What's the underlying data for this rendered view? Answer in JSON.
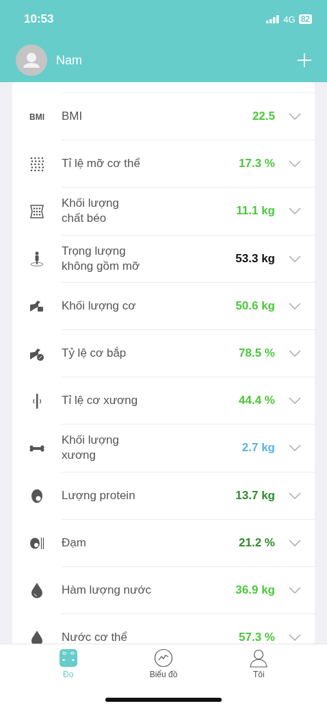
{
  "status_bar": {
    "time": "10:53",
    "network": "4G",
    "battery": "82"
  },
  "header": {
    "user_name": "Nam"
  },
  "metrics": [
    {
      "name": "BMI",
      "value": "22.5",
      "color": "#4cc83c",
      "icon_text": "BMI"
    },
    {
      "name": "Tỉ lệ mỡ cơ thể",
      "value": "17.3 %",
      "color": "#4cc83c"
    },
    {
      "name": "Khối lượng\nchất béo",
      "value": "11.1 kg",
      "color": "#4cc83c"
    },
    {
      "name": "Trọng lượng\nkhông gồm mỡ",
      "value": "53.3 kg",
      "color": "#111111"
    },
    {
      "name": "Khối lượng cơ",
      "value": "50.6 kg",
      "color": "#4cc83c"
    },
    {
      "name": "Tỷ lệ cơ bắp",
      "value": "78.5 %",
      "color": "#4cc83c"
    },
    {
      "name": "Tỉ lệ cơ xương",
      "value": "44.4 %",
      "color": "#4cc83c"
    },
    {
      "name": "Khối lượng\nxương",
      "value": "2.7 kg",
      "color": "#5ab4e6"
    },
    {
      "name": "Lượng protein",
      "value": "13.7 kg",
      "color": "#2e8b2e"
    },
    {
      "name": "Đạm",
      "value": "21.2 %",
      "color": "#2e8b2e"
    },
    {
      "name": "Hàm lượng nước",
      "value": "36.9 kg",
      "color": "#4cc83c"
    },
    {
      "name": "Nước cơ thể",
      "value": "57.3 %",
      "color": "#4cc83c"
    }
  ],
  "tabs": [
    {
      "label": "Đo",
      "selected": true
    },
    {
      "label": "Biểu đồ",
      "selected": false
    },
    {
      "label": "Tôi",
      "selected": false
    }
  ]
}
